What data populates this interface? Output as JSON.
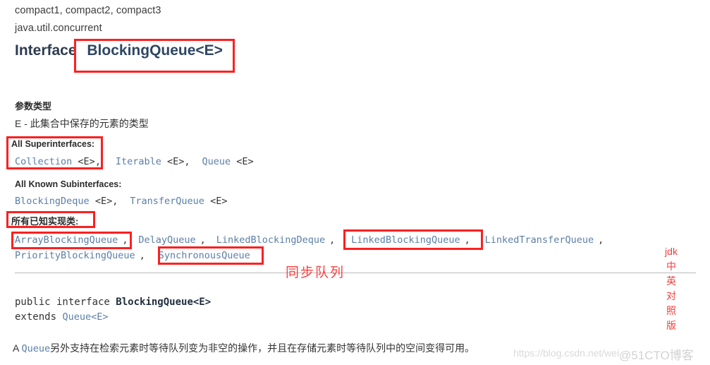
{
  "header": {
    "modules_line": "compact1, compact2, compact3",
    "package_line": "java.util.concurrent",
    "interface_keyword": "Interface",
    "interface_name": "BlockingQueue<E>"
  },
  "type_parameters": {
    "heading": "参数类型",
    "entry": "E - 此集合中保存的元素的类型"
  },
  "superinterfaces": {
    "label": "All Superinterfaces:",
    "items": [
      {
        "name": "Collection",
        "generic": "<E>",
        "sep": ","
      },
      {
        "name": "Iterable",
        "generic": "<E>",
        "sep": ","
      },
      {
        "name": "Queue",
        "generic": "<E>",
        "sep": ""
      }
    ]
  },
  "subinterfaces": {
    "label": "All Known Subinterfaces:",
    "items": [
      {
        "name": "BlockingDeque",
        "generic": "<E>",
        "sep": ","
      },
      {
        "name": "TransferQueue",
        "generic": "<E>",
        "sep": ""
      }
    ]
  },
  "implementing_classes": {
    "label": "所有已知实现类:",
    "row1": [
      {
        "name": "ArrayBlockingQueue",
        "sep": ","
      },
      {
        "name": "DelayQueue",
        "sep": ","
      },
      {
        "name": "LinkedBlockingDeque",
        "sep": ","
      },
      {
        "name": "LinkedBlockingQueue",
        "sep": ","
      },
      {
        "name": "LinkedTransferQueue",
        "sep": ","
      }
    ],
    "row2": [
      {
        "name": "PriorityBlockingQueue",
        "sep": ","
      },
      {
        "name": "SynchronousQueue",
        "sep": ""
      }
    ]
  },
  "annotation": {
    "sync_queue": "同步队列"
  },
  "declaration": {
    "line1_modifiers": "public interface ",
    "line1_name": "BlockingQueue<E>",
    "line2_keyword": "extends ",
    "line2_type": "Queue<E>"
  },
  "description": {
    "lead_a": "A ",
    "lead_link": "Queue",
    "body": "另外支持在检索元素时等待队列变为非空的操作，并且在存储元素时等待队列中的空间变得可用。"
  },
  "side_column": {
    "chars": [
      "jdk",
      "中",
      "英",
      "对",
      "照",
      "版"
    ]
  },
  "watermarks": {
    "url": "https://blog.csdn.net/wei",
    "site": "@51CTO博客"
  },
  "colors": {
    "highlight_red": "#fc2020",
    "annotation_red": "#fc4040",
    "link_blue": "#5b7fa6",
    "title_navy": "#2e3b4e",
    "rule_gray": "#b9b9b9"
  }
}
